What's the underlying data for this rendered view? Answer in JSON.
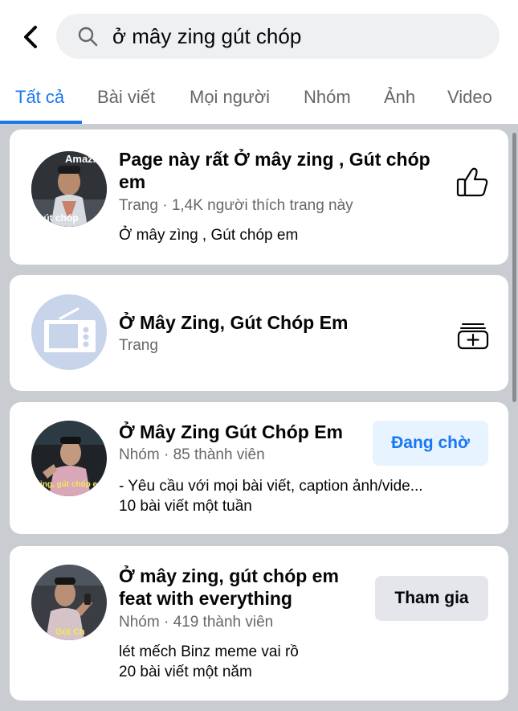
{
  "search": {
    "query": "ở mây zing gút chóp"
  },
  "tabs": [
    {
      "label": "Tất cả",
      "active": true
    },
    {
      "label": "Bài viết"
    },
    {
      "label": "Mọi người"
    },
    {
      "label": "Nhóm"
    },
    {
      "label": "Ảnh"
    },
    {
      "label": "Video"
    }
  ],
  "results": [
    {
      "title_line1": "Page này rất Ở mây zing , Gút chóp",
      "title_line2": "em",
      "meta": "Trang · 1,4K người thích trang này",
      "desc": "Ở mây zìng , Gút chóp em",
      "avatar_caption_top": "Amazing",
      "avatar_caption_bottom": "gút chóp",
      "action_icon": "thumbs-up-icon"
    },
    {
      "title": "Ở Mây Zing, Gút Chóp Em",
      "meta": "Trang",
      "action_icon": "add-to-collection-icon",
      "avatar_icon": "tv-icon"
    },
    {
      "title": "Ở Mây Zing Gút Chóp Em",
      "meta": "Nhóm · 85 thành viên",
      "desc_line1": "- Yêu cầu với mọi bài viết, caption ảnh/vide...",
      "desc_line2": "10 bài viết một tuần",
      "avatar_caption_bottom": "zing, gút chóp em",
      "button": "Đang chờ"
    },
    {
      "title_line1": "Ở mây zing, gút chóp em",
      "title_line2": "feat with everything",
      "meta": "Nhóm · 419 thành viên",
      "desc_line1": "lét mếch Binz meme vai rồ",
      "desc_line2": "20 bài viết một năm",
      "avatar_caption_bottom": "Gút Ch",
      "button": "Tham gia"
    }
  ],
  "colors": {
    "accent": "#1877f2",
    "background": "#c9ccd1",
    "secondary_text": "#65676b"
  }
}
